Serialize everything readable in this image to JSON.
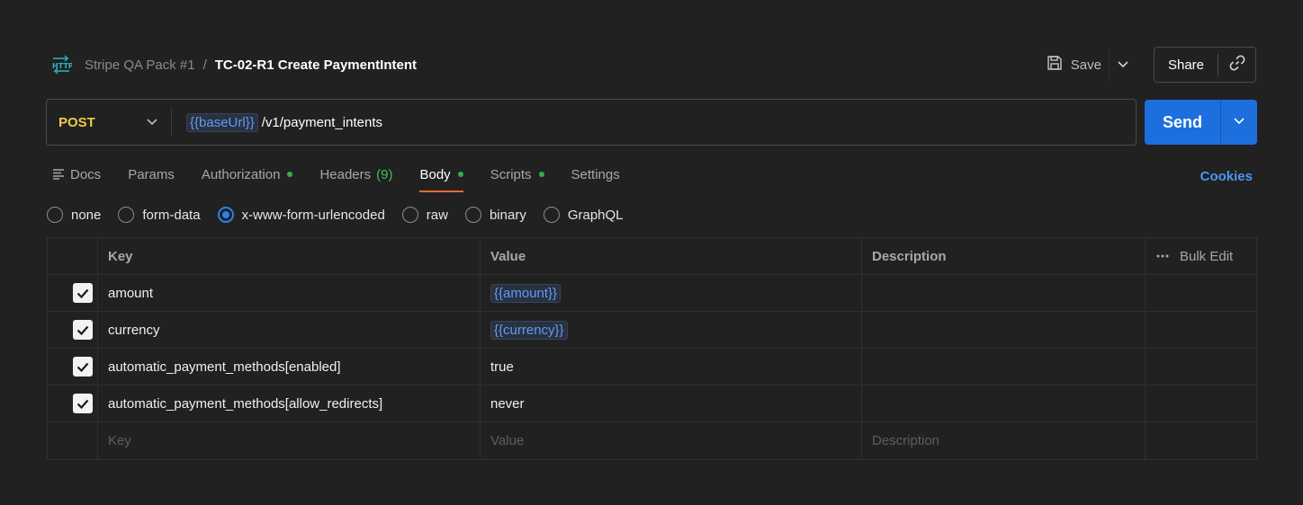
{
  "header": {
    "collection": "Stripe QA Pack #1",
    "separator": "/",
    "request_name": "TC-02-R1 Create PaymentIntent",
    "save_label": "Save",
    "share_label": "Share"
  },
  "request": {
    "method": "POST",
    "url_variable": "{{baseUrl}}",
    "url_path": "/v1/payment_intents",
    "send_label": "Send"
  },
  "tabs": [
    {
      "label": "Docs"
    },
    {
      "label": "Params"
    },
    {
      "label": "Authorization"
    },
    {
      "label": "Headers",
      "count": "(9)"
    },
    {
      "label": "Body"
    },
    {
      "label": "Scripts"
    },
    {
      "label": "Settings"
    }
  ],
  "cookies_label": "Cookies",
  "body_types": [
    "none",
    "form-data",
    "x-www-form-urlencoded",
    "raw",
    "binary",
    "GraphQL"
  ],
  "body_type_selected": "x-www-form-urlencoded",
  "table": {
    "headers": {
      "key": "Key",
      "value": "Value",
      "description": "Description",
      "bulk_edit": "Bulk Edit"
    },
    "rows": [
      {
        "key": "amount",
        "value": "{{amount}}",
        "checked": true
      },
      {
        "key": "currency",
        "value": "{{currency}}",
        "checked": true
      },
      {
        "key": "automatic_payment_methods[enabled]",
        "value": "true",
        "checked": true
      },
      {
        "key": "automatic_payment_methods[allow_redirects]",
        "value": "never",
        "checked": true
      }
    ],
    "placeholders": {
      "key": "Key",
      "value": "Value",
      "description": "Description"
    }
  },
  "colors": {
    "background": "#212121",
    "method_post": "#f3c94b",
    "send_button": "#1d6fde",
    "variable": "#5c9df5",
    "active_tab_underline": "#f06b2b",
    "status_dot": "#29b34f",
    "link": "#4b97f3"
  }
}
